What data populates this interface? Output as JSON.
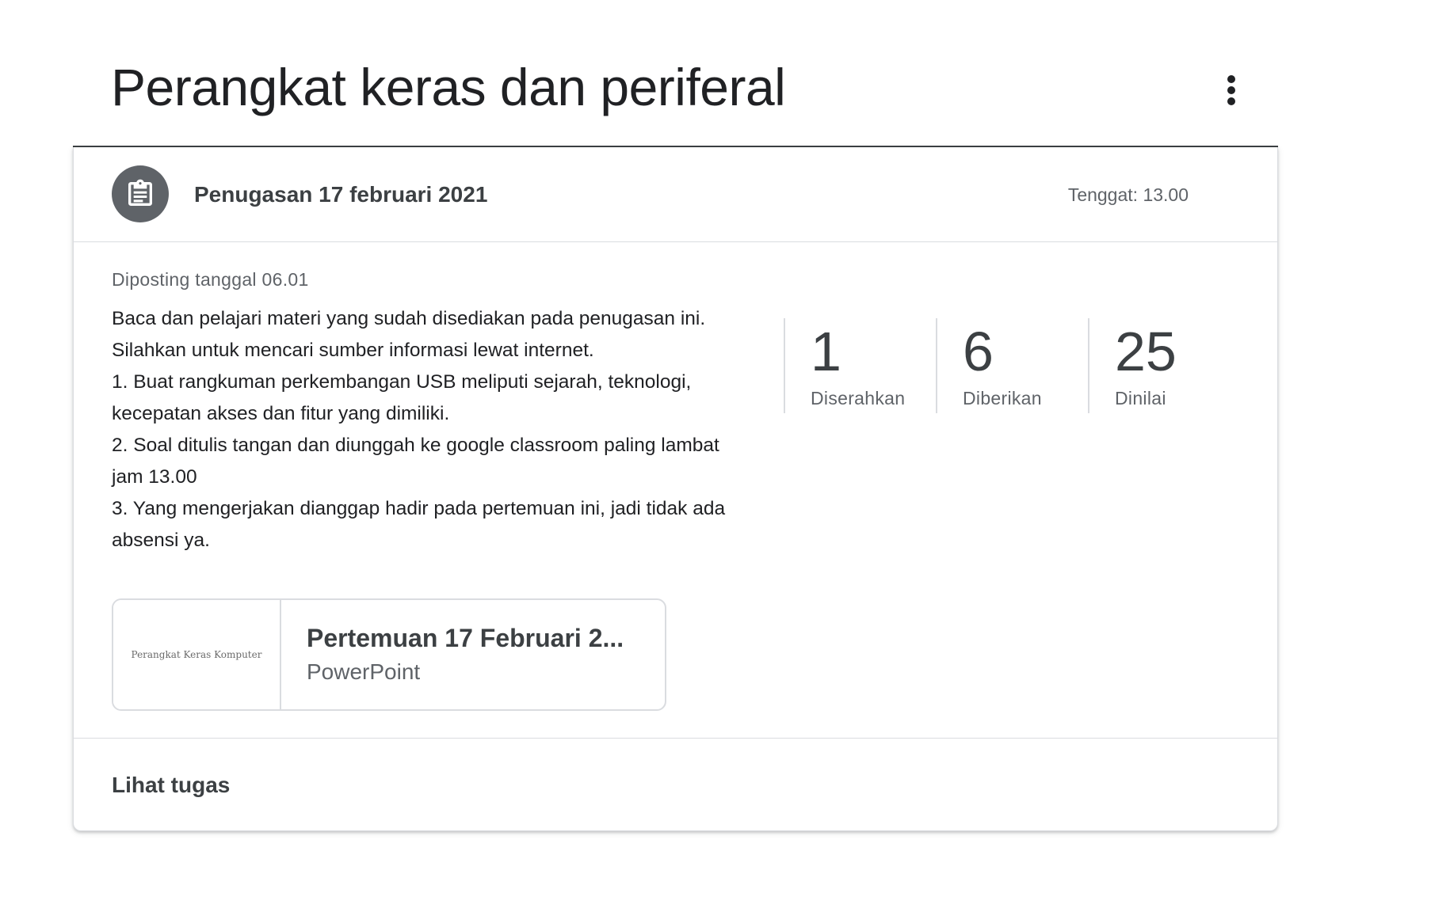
{
  "topic": {
    "title": "Perangkat keras dan periferal",
    "menu_icon": "more-vert-icon"
  },
  "assignment": {
    "icon": "assignment-icon",
    "title": "Penugasan 17 februari 2021",
    "due": "Tenggat: 13.00",
    "posted": "Diposting tanggal 06.01",
    "description_lines": [
      "Baca dan pelajari materi yang sudah disediakan pada penugasan ini.",
      "Silahkan untuk mencari sumber informasi lewat internet.",
      "1. Buat rangkuman perkembangan USB meliputi sejarah, teknologi,",
      "kecepatan akses dan fitur yang dimiliki.",
      "2. Soal ditulis tangan dan diunggah ke google classroom paling lambat",
      "jam 13.00",
      "3. Yang mengerjakan dianggap hadir pada pertemuan ini, jadi tidak ada",
      "absensi ya."
    ],
    "stats": [
      {
        "value": "1",
        "label": "Diserahkan"
      },
      {
        "value": "6",
        "label": "Diberikan"
      },
      {
        "value": "25",
        "label": "Dinilai"
      }
    ],
    "attachment": {
      "thumbnail_text": "Perangkat Keras Komputer",
      "title": "Pertemuan 17 Februari 2...",
      "type": "PowerPoint"
    },
    "view_link": "Lihat tugas"
  }
}
